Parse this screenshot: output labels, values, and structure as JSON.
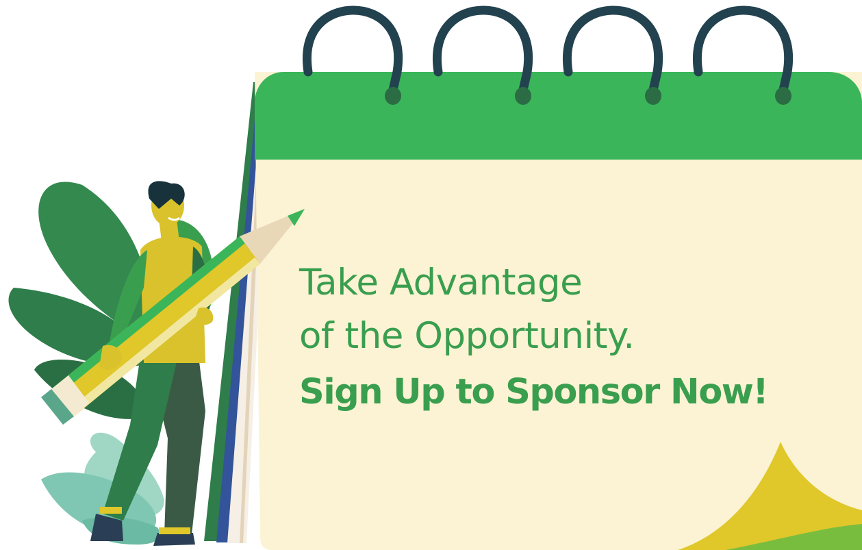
{
  "headline": {
    "line1": "Take Advantage",
    "line2": "of the Opportunity.",
    "cta": "Sign Up to Sponsor Now!"
  },
  "icons": [
    "calendar-icon",
    "pencil-icon",
    "person-figure",
    "leaf-decoration"
  ],
  "colors": {
    "calendar_header": "#3bb55a",
    "calendar_page": "#fbf3d4",
    "ring": "#23424f",
    "text": "#3a9e4f",
    "accent_yellow": "#e0c72a",
    "dark_leaf": "#2f7d4a",
    "light_leaf": "#9fd7c4"
  }
}
